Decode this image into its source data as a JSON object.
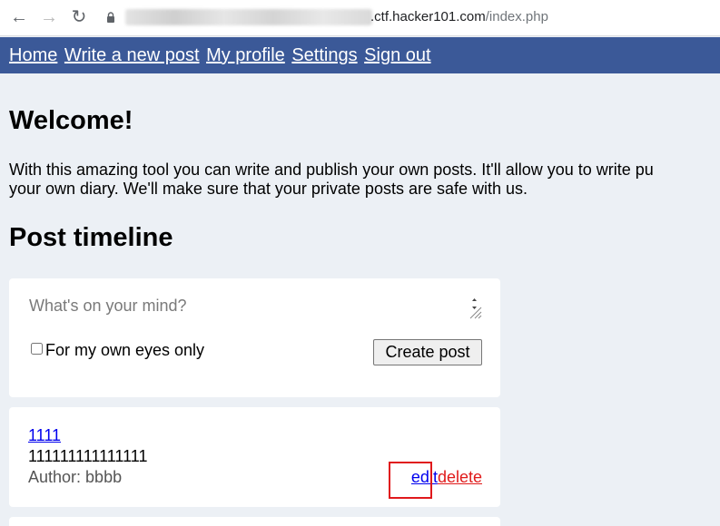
{
  "browser": {
    "url_host": ".ctf.hacker101.com",
    "url_path": "/index.php"
  },
  "nav": {
    "items": [
      "Home",
      "Write a new post",
      "My profile",
      "Settings",
      "Sign out"
    ]
  },
  "welcome": {
    "title": "Welcome!",
    "line1": "With this amazing tool you can write and publish your own posts. It'll allow you to write pu",
    "line2": "your own diary. We'll make sure that your private posts are safe with us."
  },
  "timeline": {
    "title": "Post timeline"
  },
  "composer": {
    "placeholder": "What's on your mind?",
    "private_label": "For my own eyes only",
    "private_checked": false,
    "submit_label": "Create post"
  },
  "posts": [
    {
      "title": "1111",
      "body": "111111111111111",
      "author_label": "Author: ",
      "author": "bbbb",
      "edit_label": "edit",
      "delete_label": "delete"
    }
  ],
  "colors": {
    "nav_bg": "#3b5998",
    "page_bg": "#ecf0f5",
    "link": "#0000ee",
    "delete": "#e01b1b",
    "highlight": "#e0191c"
  }
}
